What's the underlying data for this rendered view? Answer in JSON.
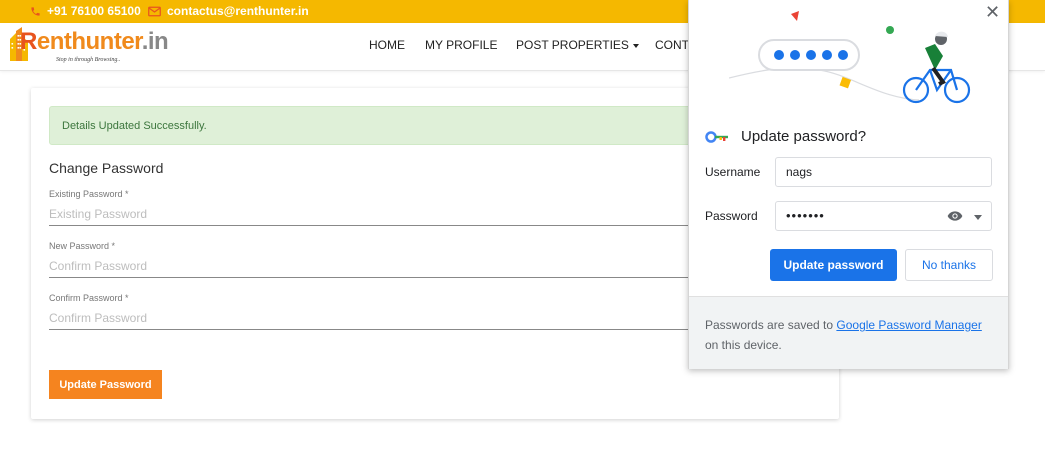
{
  "topbar": {
    "phone": "+91 76100 65100",
    "email": "contactus@renthunter.in",
    "bg_color": "#f5b800"
  },
  "logo": {
    "brand_r": "R",
    "brand_rest": "enthunter",
    "brand_tld": ".in",
    "tagline": "Stop in through Browsing.."
  },
  "nav": {
    "items": [
      "HOME",
      "MY PROFILE",
      "POST PROPERTIES",
      "CONTA"
    ]
  },
  "form": {
    "alert": "Details Updated Successfully.",
    "title": "Change Password",
    "fields": [
      {
        "label": "Existing Password *",
        "placeholder": "Existing Password"
      },
      {
        "label": "New Password *",
        "placeholder": "Confirm Password"
      },
      {
        "label": "Confirm Password *",
        "placeholder": "Confirm Password"
      }
    ],
    "submit_label": "Update Password",
    "submit_color": "#f5841f"
  },
  "popup": {
    "close_glyph": "✕",
    "title": "Update password?",
    "username_label": "Username",
    "username_value": "nags",
    "password_label": "Password",
    "password_value": "•••••••",
    "primary_button": "Update password",
    "secondary_button": "No thanks",
    "footer_prefix": "Passwords are saved to ",
    "footer_link": "Google Password Manager",
    "footer_suffix": " on this device.",
    "accent_color": "#1a73e8"
  }
}
